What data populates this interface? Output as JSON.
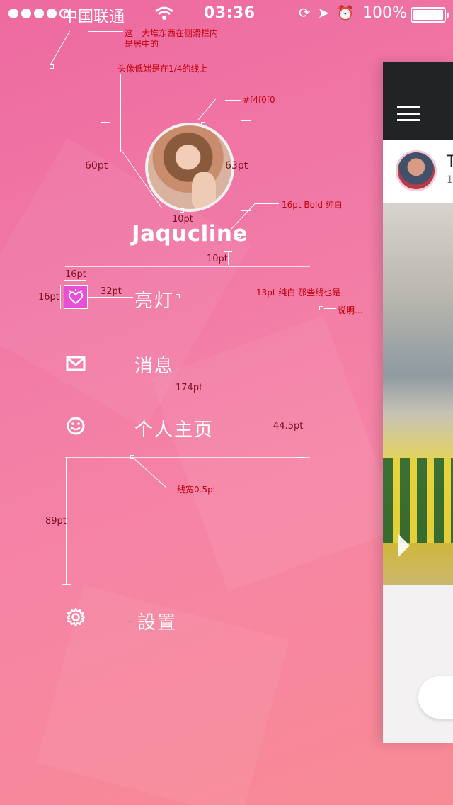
{
  "status_bar": {
    "carrier": "中国联通",
    "time": "03:36",
    "battery": "100%"
  },
  "profile": {
    "name": "Jaqucline",
    "avatar_border_color": "#f4f0f0"
  },
  "menu": {
    "items": [
      {
        "label": "亮灯",
        "icon": "heart-light-icon"
      },
      {
        "label": "消息",
        "icon": "mail-icon"
      },
      {
        "label": "个人主页",
        "icon": "smiley-icon"
      },
      {
        "label": "設置",
        "icon": "gear-icon"
      }
    ]
  },
  "annotations": {
    "centered_note": "这一大堆东西在侧滑栏内是居中的",
    "centered_note_line1": "这一大堆东西在侧滑栏内",
    "centered_note_line2": "是居中的",
    "avatar_quarter_note": "头像低端是在1/4的线上",
    "border_color_note": "#f4f0f0",
    "name_font_note": "16pt Bold 纯白",
    "menu_font_note": "13pt 纯白 那些线也是",
    "explain_note": "说明...",
    "line_width_note": "线宽0.5pt",
    "dim_60": "60pt",
    "dim_63": "63pt",
    "dim_10a": "10pt",
    "dim_10b": "10pt",
    "dim_16w": "16pt",
    "dim_16h": "16pt",
    "dim_32": "32pt",
    "dim_174": "174pt",
    "dim_44_5": "44.5pt",
    "dim_89": "89pt"
  },
  "preview": {
    "post_title": "T",
    "post_sub": "1"
  },
  "colors": {
    "background_start": "#ee6aa0",
    "background_end": "#f88a94",
    "annotation_text": "#c7000b",
    "preview_topbar": "#222325"
  }
}
